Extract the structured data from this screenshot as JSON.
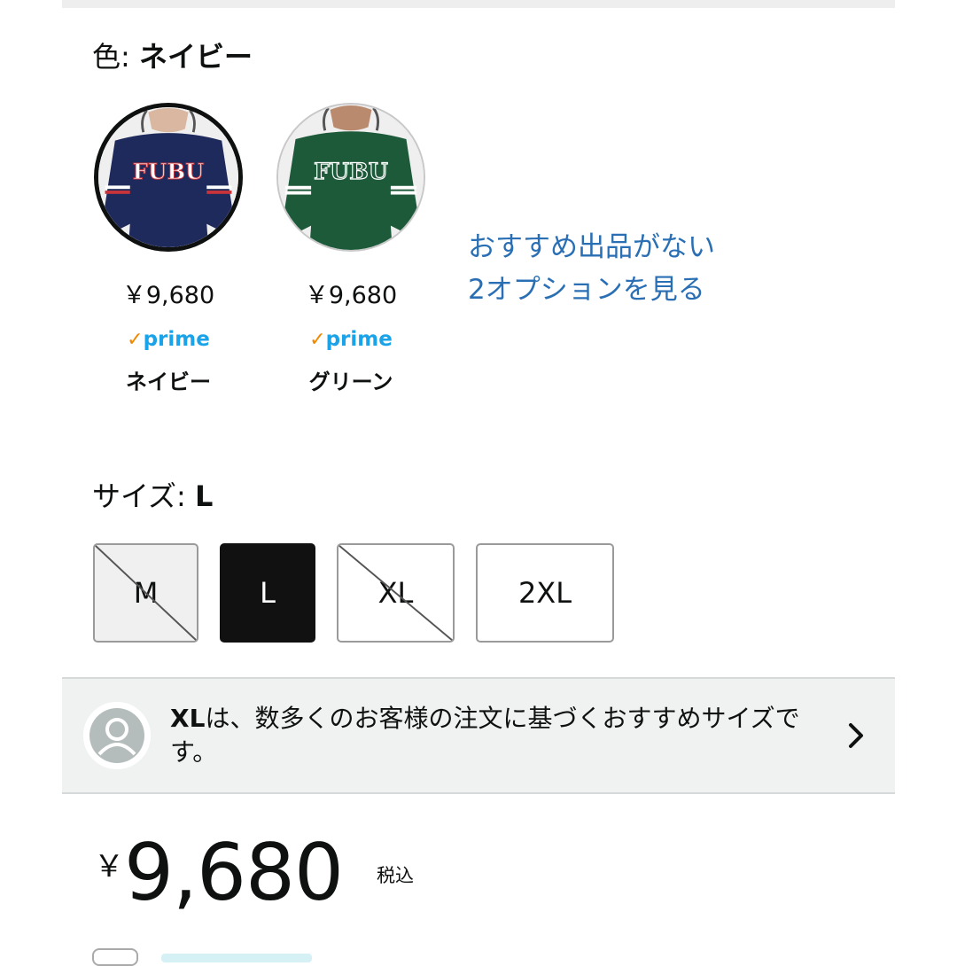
{
  "color_selector": {
    "label": "色:",
    "selected_value": "ネイビー",
    "swatches": [
      {
        "price": "￥9,680",
        "prime_label": "prime",
        "name": "ネイビー",
        "shirt_color": "#1f2a5c",
        "selected": true,
        "print_text": "FUBU"
      },
      {
        "price": "￥9,680",
        "prime_label": "prime",
        "name": "グリーン",
        "shirt_color": "#1d5a3a",
        "selected": false,
        "print_text": "FUBU"
      }
    ],
    "more_options_link": "おすすめ出品がない\n2オプションを見る"
  },
  "size_selector": {
    "label": "サイズ:",
    "selected_value": "L",
    "options": [
      {
        "label": "M",
        "available": false
      },
      {
        "label": "L",
        "available": true,
        "selected": true
      },
      {
        "label": "XL",
        "available": false
      },
      {
        "label": "2XL",
        "available": true
      }
    ]
  },
  "recommendation": {
    "highlight": "XL",
    "text": "は、数多くのお客様の注文に基づくおすすめサイズです。"
  },
  "price": {
    "currency": "￥",
    "amount": "9,680",
    "tax_note": "税込"
  },
  "colors": {
    "link": "#2a6fb4",
    "prime_blue": "#1aa3e8",
    "prime_check": "#f08804",
    "selected_size_bg": "#111111"
  }
}
